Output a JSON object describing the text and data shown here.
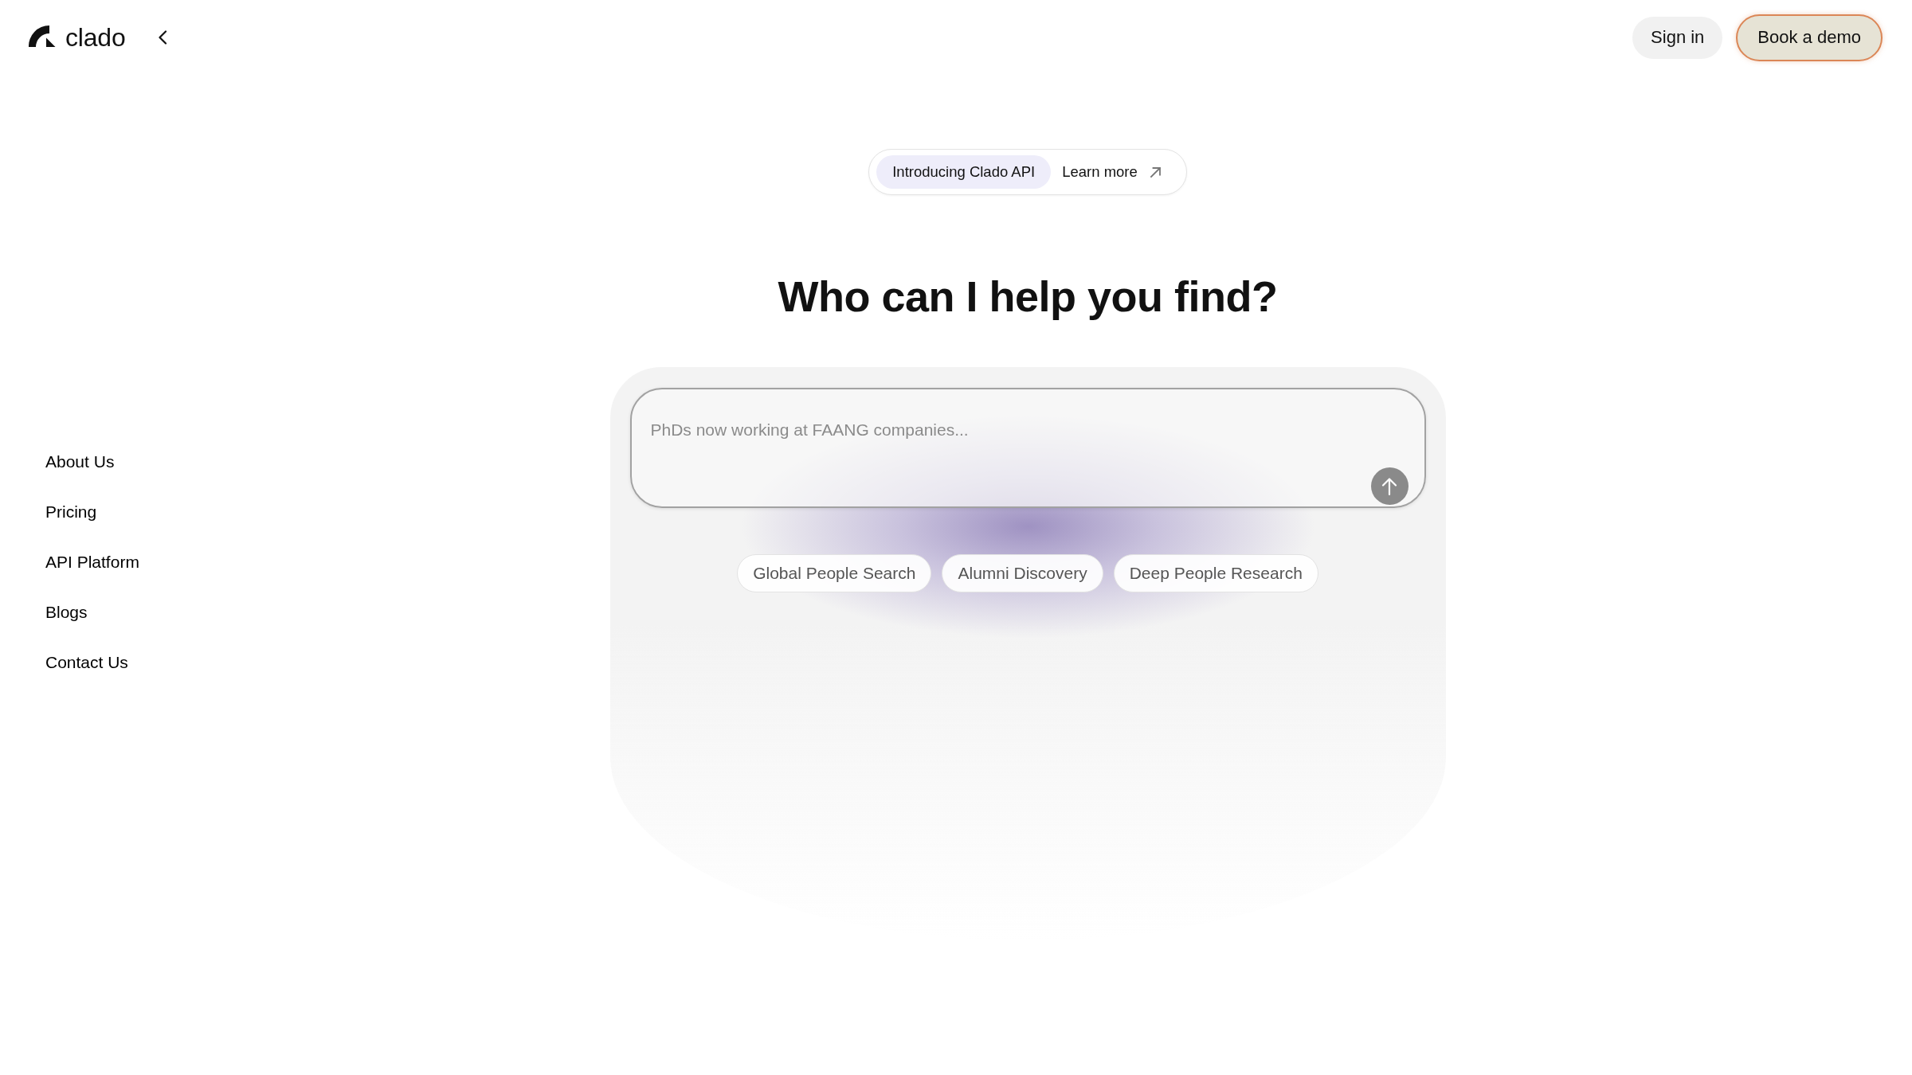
{
  "header": {
    "logo": "clado",
    "actions": [
      {
        "label": "Sign in",
        "kind": "secondary"
      },
      {
        "label": "Book a demo",
        "kind": "primary"
      }
    ]
  },
  "sidebar": {
    "items": [
      "About Us",
      "Pricing",
      "API Platform",
      "Blogs",
      "Contact Us"
    ]
  },
  "announcement": {
    "badge": "Introducing Clado API",
    "link": "Learn more"
  },
  "heading": "Who can I help you find?",
  "search": {
    "placeholder": "PhDs now working at FAANG companies..."
  },
  "suggestions": [
    "Global People Search",
    "Alumni Discovery",
    "Deep People Research"
  ]
}
